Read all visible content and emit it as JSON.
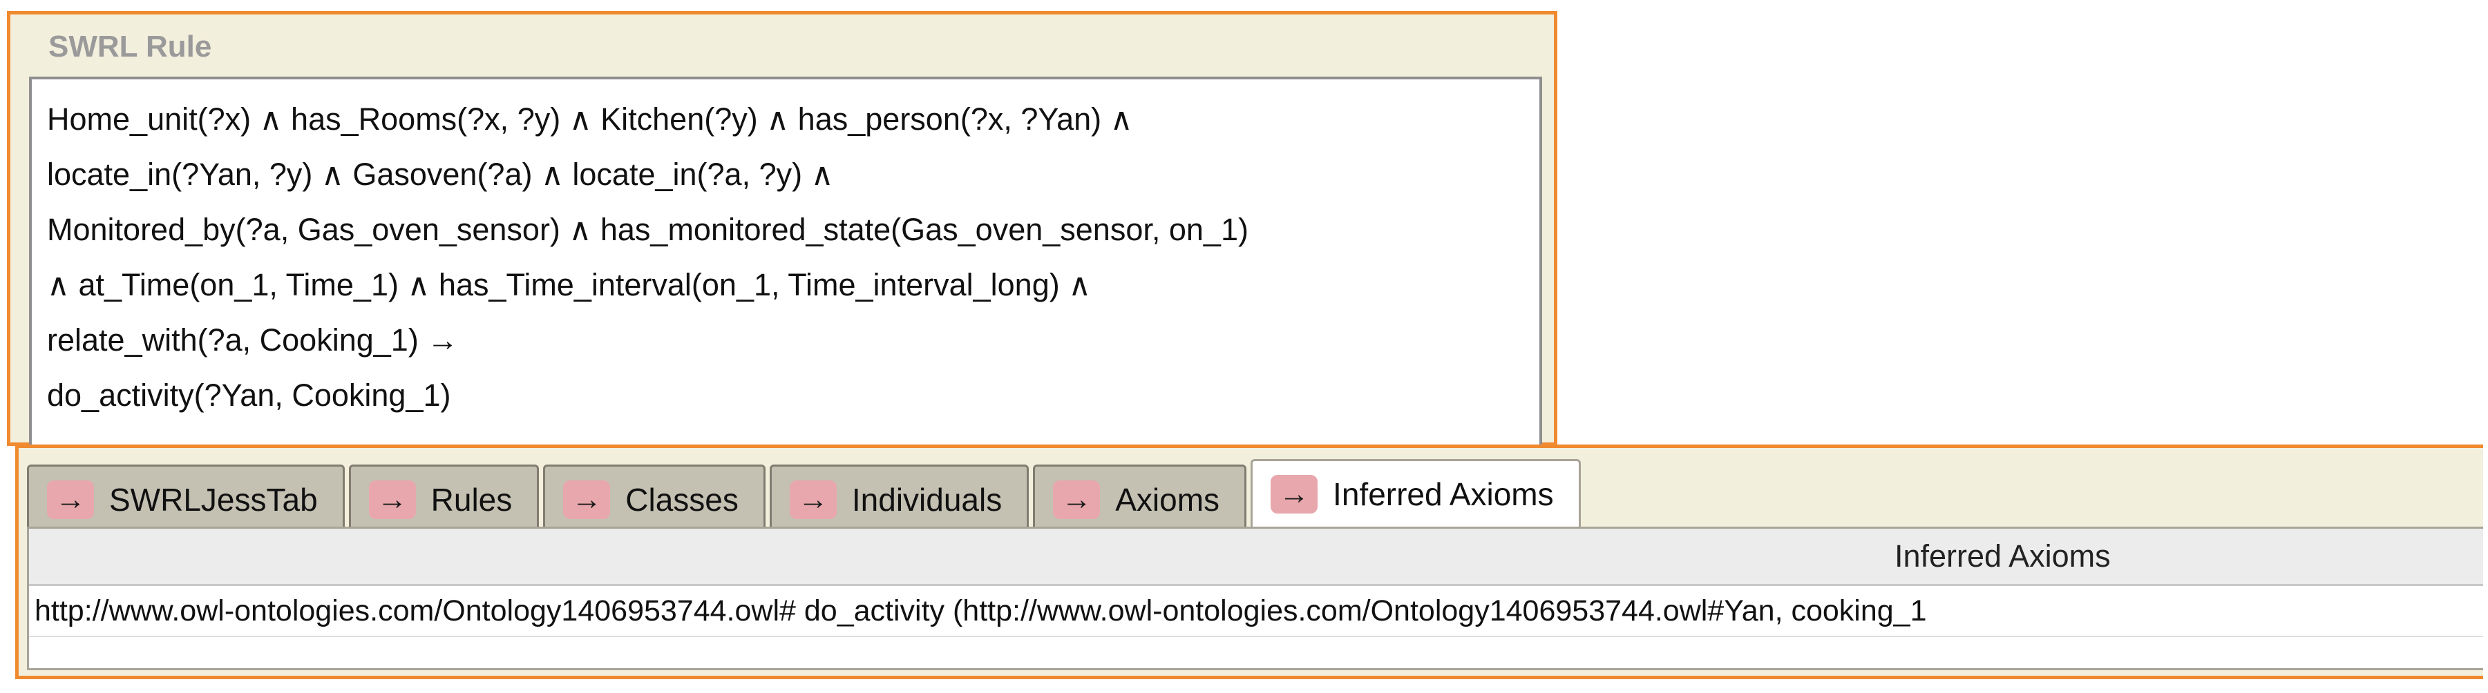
{
  "rule_panel": {
    "title": "SWRL Rule",
    "lines": [
      "Home_unit(?x) ∧ has_Rooms(?x, ?y) ∧ Kitchen(?y) ∧ has_person(?x, ?Yan) ∧",
      "locate_in(?Yan, ?y) ∧ Gasoven(?a) ∧ locate_in(?a, ?y) ∧",
      "Monitored_by(?a, Gas_oven_sensor) ∧ has_monitored_state(Gas_oven_sensor, on_1)",
      "∧  at_Time(on_1, Time_1) ∧ has_Time_interval(on_1, Time_interval_long) ∧",
      "relate_with(?a, Cooking_1) →",
      "do_activity(?Yan, Cooking_1)"
    ]
  },
  "tabs": {
    "icon": "arrow-right-icon",
    "icon_glyph": "→",
    "icon_color": "#e8a7ac",
    "items": [
      {
        "label": "SWRLJessTab"
      },
      {
        "label": "Rules"
      },
      {
        "label": "Classes"
      },
      {
        "label": "Individuals"
      },
      {
        "label": "Axioms"
      },
      {
        "label": "Inferred Axioms",
        "selected": true
      }
    ]
  },
  "table": {
    "column_header": "Inferred Axioms",
    "rows": [
      "http://www.owl-ontologies.com/Ontology1406953744.owl# do_activity (http://www.owl-ontologies.com/Ontology1406953744.owl#Yan, cooking_1"
    ]
  },
  "colors": {
    "highlight_border": "#f08a2e",
    "panel_background": "#f3efdd",
    "tab_background": "#c4c0b2"
  }
}
